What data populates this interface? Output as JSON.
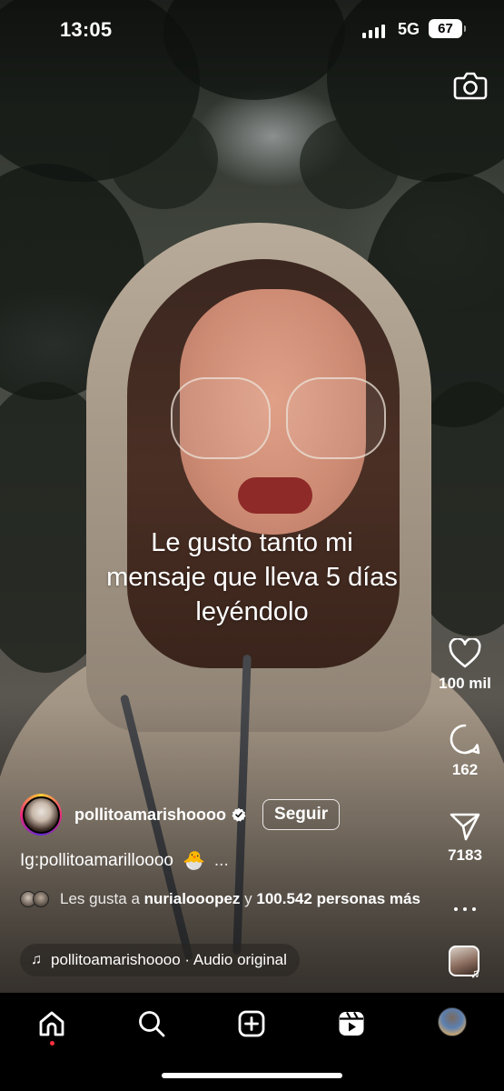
{
  "status_bar": {
    "time": "13:05",
    "network": "5G",
    "battery": "67"
  },
  "reel": {
    "overlay_text_lines": [
      "Le gusto tanto mi",
      "mensaje que lleva 5 días",
      "leyéndolo"
    ]
  },
  "actions": {
    "likes": "100 mil",
    "comments": "162",
    "shares": "7183"
  },
  "author": {
    "username": "pollitoamarishoooo",
    "follow_label": "Seguir"
  },
  "caption": {
    "text": "Ig:pollitoamarilloooo",
    "emoji": "🐣",
    "more": "..."
  },
  "liked_by": {
    "prefix": "Les gusta a",
    "user": "nurialooopez",
    "connector": "y",
    "others": "100.542 personas",
    "suffix": "más"
  },
  "audio": {
    "label": "pollitoamarishoooo · Audio original"
  },
  "icons": {
    "camera": "camera-icon",
    "heart": "heart-icon",
    "comment": "comment-icon",
    "share": "share-icon",
    "home": "home-icon",
    "search": "search-icon",
    "create": "plus-square-icon",
    "reels": "reels-icon",
    "music": "music-note-icon"
  },
  "colors": {
    "notification_dot": "#ff3040",
    "avatar_ring": [
      "#f9ce34",
      "#ee2a7b",
      "#6228d7"
    ]
  }
}
